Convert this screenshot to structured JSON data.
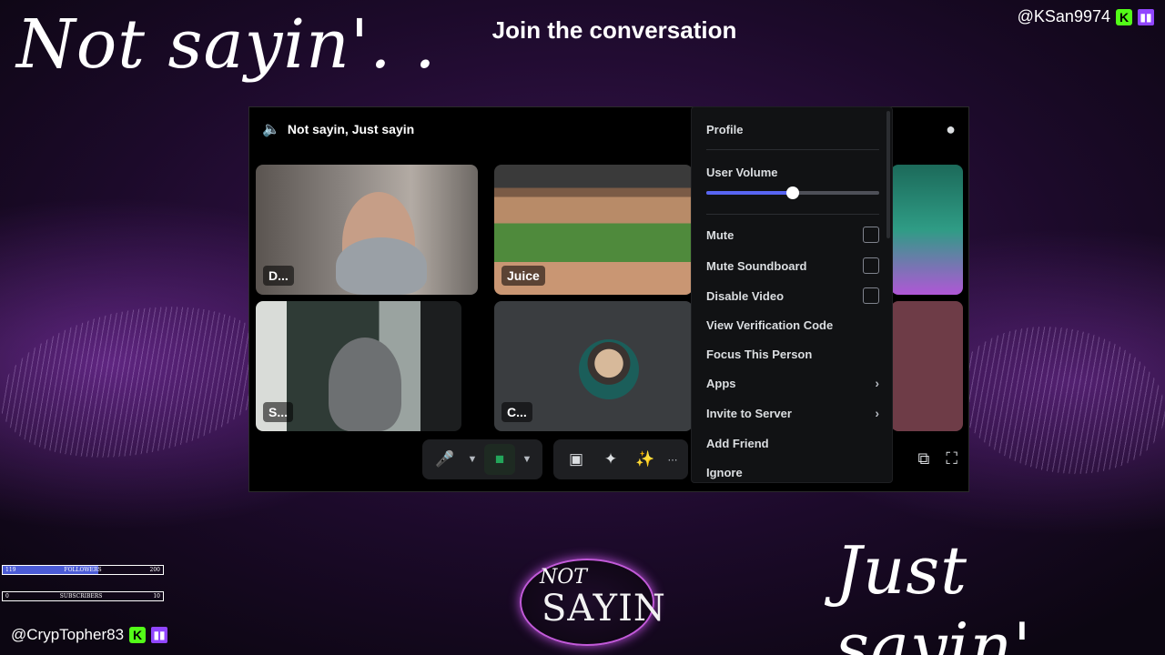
{
  "overlay": {
    "script_top": "Not sayin'. .",
    "script_bottom": "Just sayin'. .",
    "headline": "Join the conversation",
    "top_handle": "@KSan9974",
    "bottom_handle": "@CrypTopher83",
    "logo_line1": "NOT",
    "logo_line2": "SAYIN",
    "followers": {
      "label": "FOLLOWERS",
      "current": "119",
      "goal": "200",
      "fraction": 0.595
    },
    "subscribers": {
      "label": "SUBSCRIBERS",
      "current": "0",
      "goal": "10",
      "fraction": 0.0
    }
  },
  "call": {
    "channel_title": "Not sayin, Just sayin",
    "participants": [
      {
        "name": "D..."
      },
      {
        "name": "Juice"
      },
      {
        "name": "S..."
      },
      {
        "name": "C..."
      }
    ]
  },
  "context_menu": {
    "profile": "Profile",
    "user_volume": "User Volume",
    "volume_level": 0.5,
    "mute": "Mute",
    "mute_soundboard": "Mute Soundboard",
    "disable_video": "Disable Video",
    "view_verification_code": "View Verification Code",
    "focus_this_person": "Focus This Person",
    "apps": "Apps",
    "invite_to_server": "Invite to Server",
    "add_friend": "Add Friend",
    "ignore": "Ignore"
  },
  "colors": {
    "accent": "#5865f2",
    "video_on": "#23a55a",
    "kick_green": "#53fc18",
    "twitch_purple": "#9146ff"
  }
}
